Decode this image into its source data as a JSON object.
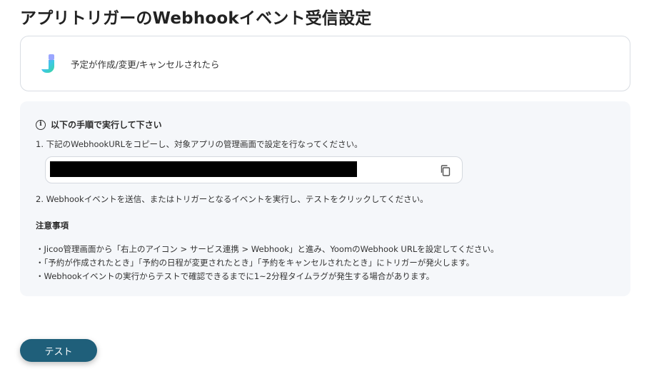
{
  "page": {
    "title": "アプリトリガーのWebhookイベント受信設定"
  },
  "trigger": {
    "label": "予定が作成/変更/キャンセルされたら",
    "app_icon": "jicoo-logo"
  },
  "instructions": {
    "heading": "以下の手順で実行して下さい",
    "info_icon_glyph": "i",
    "step1": "1. 下記のWebhookURLをコピーし、対象アプリの管理画面で設定を行なってください。",
    "webhook_url": "",
    "copy_icon": "copy-icon",
    "step2": "2. Webhookイベントを送信、またはトリガーとなるイベントを実行し、テストをクリックしてください。"
  },
  "notes": {
    "title": "注意事項",
    "items": [
      "・Jicoo管理画面から「右上のアイコン > サービス連携 > Webhook」と進み、YoomのWebhook URLを設定してください。",
      "・「予約が作成されたとき」「予約の日程が変更されたとき」「予約をキャンセルされたとき」にトリガーが発火します。",
      "・Webhookイベントの実行からテストで確認できるまでに1~2分程タイムラグが発生する場合があります。"
    ]
  },
  "actions": {
    "test_label": "テスト"
  },
  "colors": {
    "primary_button": "#1f5f7a",
    "panel_bg": "#f5f7fa",
    "border": "#d9dde3"
  }
}
